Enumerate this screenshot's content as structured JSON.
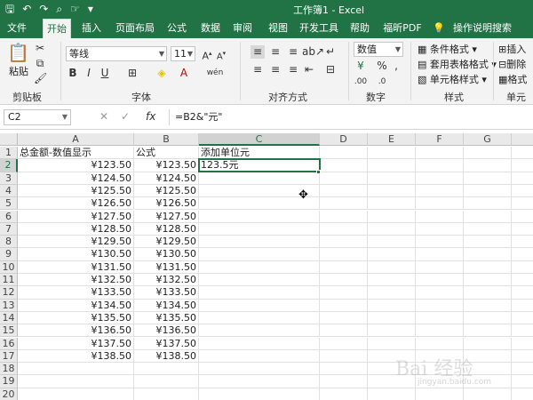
{
  "window": {
    "title": "工作簿1  -  Excel"
  },
  "tabs": [
    "文件",
    "开始",
    "插入",
    "页面布局",
    "公式",
    "数据",
    "审阅",
    "视图",
    "开发工具",
    "帮助",
    "福昕PDF",
    "操作说明搜索"
  ],
  "ribbon": {
    "paste_label": "粘贴",
    "clipboard_label": "剪贴板",
    "font_name": "等线",
    "font_size": "11",
    "font_label": "字体",
    "alignment_label": "对齐方式",
    "number_format": "数值",
    "number_label": "数字",
    "cond_format": "条件格式",
    "table_format": "套用表格格式",
    "cell_style": "单元格样式",
    "style_label": "样式",
    "insert": "插入",
    "delete": "删除",
    "format": "格式",
    "cells_label": "单元格"
  },
  "formula_bar": {
    "name_box": "C2",
    "fx": "fx",
    "formula": "=B2&\"元\""
  },
  "columns": [
    "A",
    "B",
    "C",
    "D",
    "E",
    "F",
    "G"
  ],
  "rows": [
    "1",
    "2",
    "3",
    "4",
    "5",
    "6",
    "7",
    "8",
    "9",
    "10",
    "11",
    "12",
    "13",
    "14",
    "15",
    "16",
    "17",
    "18",
    "19",
    "20"
  ],
  "headers": {
    "a1": "总金额-数值显示",
    "b1": "公式",
    "c1": "添加单位元"
  },
  "col_a": [
    "¥123.50",
    "¥124.50",
    "¥125.50",
    "¥126.50",
    "¥127.50",
    "¥128.50",
    "¥129.50",
    "¥130.50",
    "¥131.50",
    "¥132.50",
    "¥133.50",
    "¥134.50",
    "¥135.50",
    "¥136.50",
    "¥137.50",
    "¥138.50"
  ],
  "col_b": [
    "¥123.50",
    "¥124.50",
    "¥125.50",
    "¥126.50",
    "¥127.50",
    "¥128.50",
    "¥129.50",
    "¥130.50",
    "¥131.50",
    "¥132.50",
    "¥133.50",
    "¥134.50",
    "¥135.50",
    "¥136.50",
    "¥137.50",
    "¥138.50"
  ],
  "c2": "123.5元",
  "watermark": "Bai 经验",
  "watermark_sub": "jingyan.baidu.com"
}
